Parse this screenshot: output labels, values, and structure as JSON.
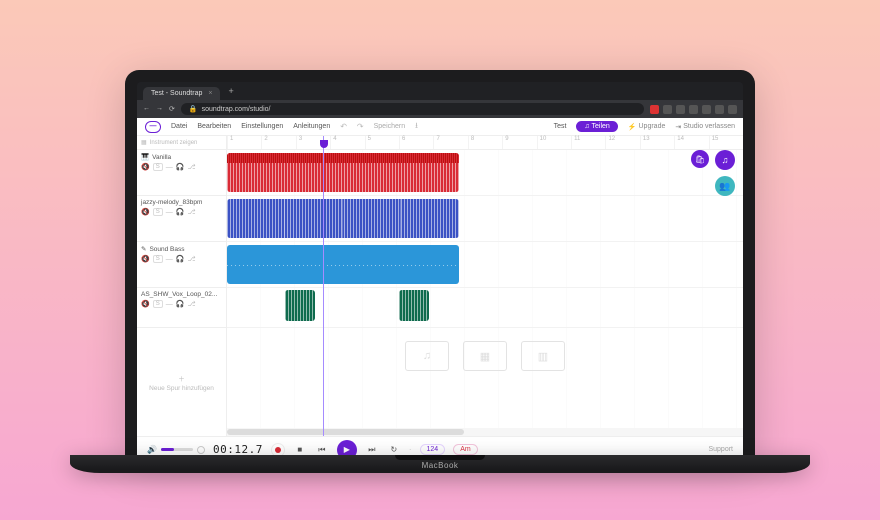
{
  "browser": {
    "tab_title": "Test - Soundtrap",
    "url": "soundtrap.com/studio/"
  },
  "menu": {
    "items": [
      "Datei",
      "Bearbeiten",
      "Einstellungen",
      "Anleitungen"
    ],
    "save_pill": "Speichern",
    "project_title": "Test",
    "share_label": "♫ Teilen",
    "upgrade_label": "Upgrade",
    "exit_label": "Studio verlassen"
  },
  "side": {
    "show_instrument": "Instrument zeigen",
    "add_track_label": "Neue Spur hinzufügen"
  },
  "tracks": [
    {
      "name": "Vanilla",
      "color": "#d92b36"
    },
    {
      "name": "jazzy-melody_83bpm",
      "color": "#3b52c4"
    },
    {
      "name": "Sound Bass",
      "color": "#2b96d9"
    },
    {
      "name": "AS_SHW_Vox_Loop_02...",
      "color": "#0f6b4e"
    }
  ],
  "ruler_ticks": [
    "1",
    "2",
    "3",
    "4",
    "5",
    "6",
    "7",
    "8",
    "9",
    "10",
    "11",
    "12",
    "13",
    "14",
    "15"
  ],
  "transport": {
    "time": "00:12.7",
    "tempo": "124",
    "key_label": "Am",
    "support": "Support"
  },
  "laptop_brand": "MacBook"
}
